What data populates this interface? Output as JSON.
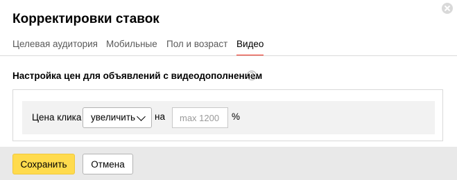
{
  "dialog": {
    "title": "Корректировки ставок",
    "tabs": [
      {
        "label": "Целевая аудитория",
        "active": false
      },
      {
        "label": "Мобильные",
        "active": false
      },
      {
        "label": "Пол и возраст",
        "active": false
      },
      {
        "label": "Видео",
        "active": true
      }
    ],
    "section_heading": "Настройка цен для объявлений с видеодополнением",
    "help_glyph": "?",
    "price": {
      "label": "Цена клика",
      "direction_value": "увеличить",
      "on_label": "на",
      "amount_value": "",
      "amount_placeholder": "max 1200",
      "unit": "%"
    },
    "buttons": {
      "save": "Сохранить",
      "cancel": "Отмена"
    },
    "colors": {
      "save_button": "#ffdb4d",
      "active_tab_underline": "#ee2211",
      "footer_background": "#e9e9e9"
    }
  }
}
